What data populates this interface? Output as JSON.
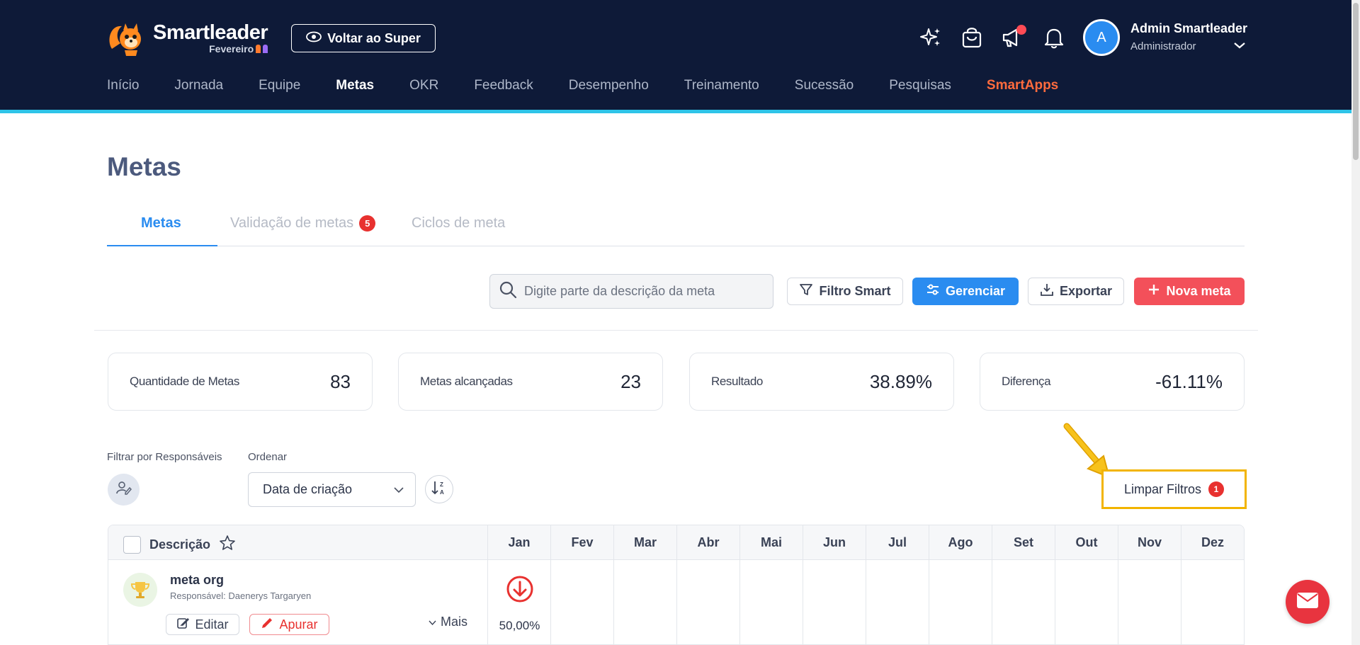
{
  "brand": {
    "name": "Smartleader",
    "sub": "Fevereiro"
  },
  "header": {
    "super_button": "Voltar ao Super",
    "user_initial": "A",
    "user_name": "Admin Smartleader",
    "user_role": "Administrador"
  },
  "nav": [
    "Início",
    "Jornada",
    "Equipe",
    "Metas",
    "OKR",
    "Feedback",
    "Desempenho",
    "Treinamento",
    "Sucessão",
    "Pesquisas",
    "SmartApps"
  ],
  "nav_active": "Metas",
  "page": {
    "title": "Metas"
  },
  "tabs": {
    "metas": "Metas",
    "validacao": "Validação de metas",
    "validacao_count": "5",
    "ciclos": "Ciclos de meta"
  },
  "toolbar": {
    "search_placeholder": "Digite parte da descrição da meta",
    "filter": "Filtro Smart",
    "manage": "Gerenciar",
    "export": "Exportar",
    "new": "Nova meta"
  },
  "stats": [
    {
      "label": "Quantidade de Metas",
      "value": "83"
    },
    {
      "label": "Metas alcançadas",
      "value": "23"
    },
    {
      "label": "Resultado",
      "value": "38.89%"
    },
    {
      "label": "Diferença",
      "value": "-61.11%"
    }
  ],
  "filters": {
    "responsaveis_label": "Filtrar por Responsáveis",
    "ordenar_label": "Ordenar",
    "ordenar_value": "Data de criação",
    "clear_label": "Limpar Filtros",
    "clear_count": "1"
  },
  "table": {
    "desc_header": "Descrição",
    "months": [
      "Jan",
      "Fev",
      "Mar",
      "Abr",
      "Mai",
      "Jun",
      "Jul",
      "Ago",
      "Set",
      "Out",
      "Nov",
      "Dez"
    ],
    "rows": [
      {
        "title": "meta org",
        "responsavel": "Responsável: Daenerys Targaryen",
        "edit": "Editar",
        "apurar": "Apurar",
        "more": "Mais",
        "jan_value": "50,00%"
      }
    ]
  },
  "colors": {
    "header_bg": "#0e1a38",
    "accent_blue": "#2a8cf0",
    "accent_red": "#f3505a",
    "smartapps": "#ff6b3d",
    "highlight": "#f2b400"
  }
}
